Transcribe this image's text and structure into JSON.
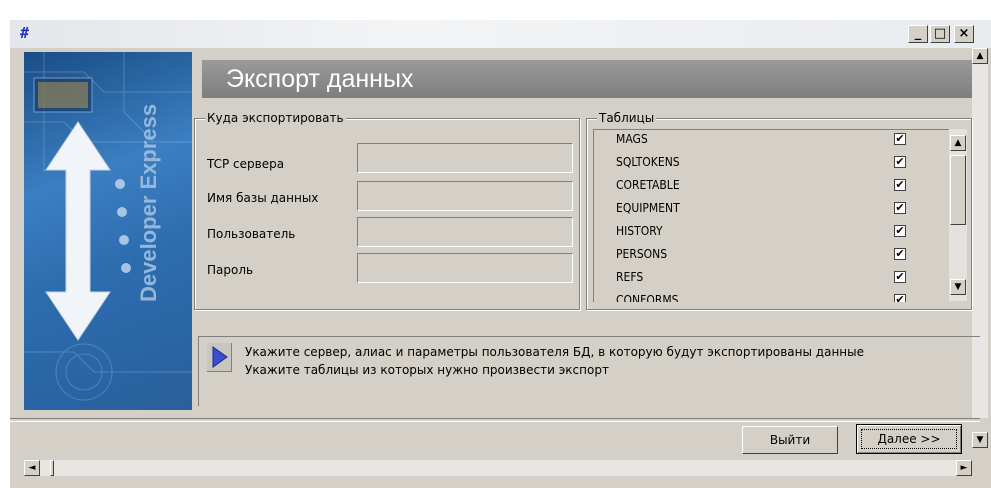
{
  "window": {
    "app_icon": "#",
    "controls": {
      "minimize": "_",
      "maximize": "□",
      "close": "×"
    }
  },
  "banner": {
    "brand_text": "Developer Express"
  },
  "header": {
    "title": "Экспорт данных"
  },
  "export_target": {
    "group_title": "Куда экспортировать",
    "fields": [
      {
        "label": "TCP сервера",
        "value": ""
      },
      {
        "label": "Имя базы данных",
        "value": ""
      },
      {
        "label": "Пользователь",
        "value": ""
      },
      {
        "label": "Пароль",
        "value": ""
      }
    ]
  },
  "tables": {
    "group_title": "Таблицы",
    "items": [
      {
        "name": "MAGS",
        "checked": true
      },
      {
        "name": "SQLTOKENS",
        "checked": true
      },
      {
        "name": "CORETABLE",
        "checked": true
      },
      {
        "name": "EQUIPMENT",
        "checked": true
      },
      {
        "name": "HISTORY",
        "checked": true
      },
      {
        "name": "PERSONS",
        "checked": true
      },
      {
        "name": "REFS",
        "checked": true
      },
      {
        "name": "CONFORMS",
        "checked": true
      }
    ],
    "check_glyph": "✔"
  },
  "info": {
    "line1": "Укажите сервер, алиас и параметры пользователя БД, в которую будут экспортированы данные",
    "line2": "Укажите таблицы из которых нужно произвести экспорт"
  },
  "buttons": {
    "exit": "Выйти",
    "next": "Далее >>"
  },
  "scroll": {
    "up": "▲",
    "down": "▼",
    "left": "◄",
    "right": "►"
  },
  "colors": {
    "face": "#d4d0c8",
    "header_gray": "#8a8a8a",
    "banner_blue": "#2c6cae",
    "info_arrow": "#3a4fd0"
  }
}
